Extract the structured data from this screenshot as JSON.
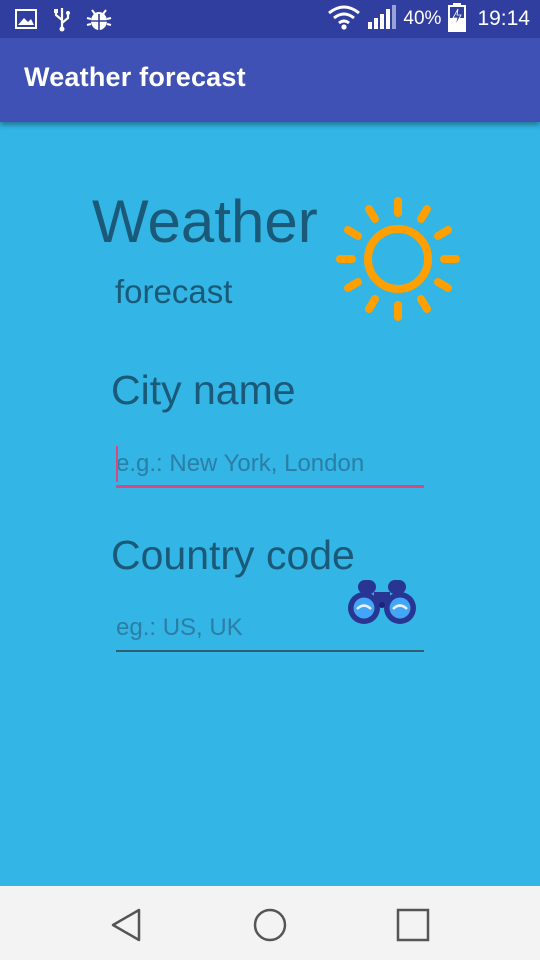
{
  "status_bar": {
    "battery_percent": "40%",
    "time": "19:14",
    "icons": [
      "image-icon",
      "usb-icon",
      "android-debug-icon",
      "wifi-icon",
      "signal-icon",
      "battery-charging-icon"
    ]
  },
  "app_bar": {
    "title": "Weather forecast"
  },
  "header": {
    "title": "Weather",
    "subtitle": "forecast",
    "icon": "sun-icon",
    "icon_color": "#ffa000"
  },
  "form": {
    "city": {
      "label": "City name",
      "placeholder": "e.g.: New York, London",
      "value": ""
    },
    "country": {
      "label": "Country code",
      "placeholder": "eg.: US, UK",
      "value": ""
    },
    "search_button_icon": "binoculars-icon"
  },
  "nav_bar": {
    "buttons": [
      "back-icon",
      "home-icon",
      "recents-icon"
    ]
  },
  "colors": {
    "status_bar": "#303f9f",
    "app_bar": "#3f51b5",
    "background": "#33b5e5",
    "accent": "#e0457b",
    "text": "#1a5a78"
  }
}
